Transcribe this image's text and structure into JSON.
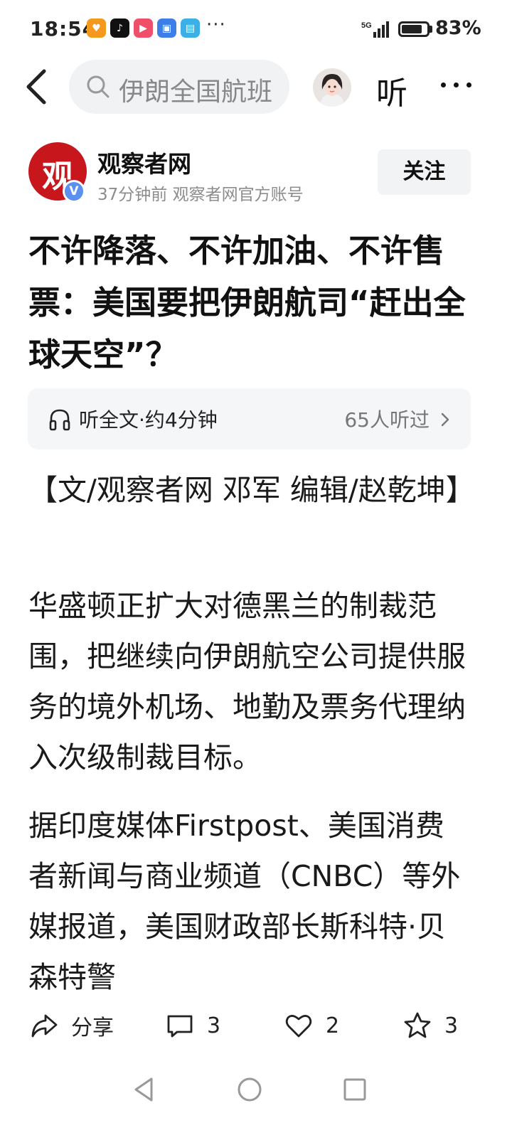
{
  "status_bar": {
    "time": "18:54",
    "network": "5G",
    "battery_text": "83%",
    "battery_level": 0.83,
    "app_icons": [
      "heart-app-icon",
      "tiktok-app-icon",
      "video-app-icon",
      "wallet-app-icon",
      "book-app-icon"
    ],
    "more": "···"
  },
  "top_nav": {
    "search_text": "伊朗全国航班",
    "listen_label": "听"
  },
  "author": {
    "logo_text": "观",
    "name": "观察者网",
    "meta": "37分钟前  观察者网官方账号",
    "verified": "V",
    "follow_label": "关注"
  },
  "article": {
    "title": "不许降落、不许加油、不许售票：美国要把伊朗航司“赶出全球天空”？",
    "audio": {
      "label": "听全文·约4分钟",
      "listeners": "65人听过"
    },
    "byline": "【文/观察者网 邓军 编辑/赵乾坤】",
    "paragraph_1": "华盛顿正扩大对德黑兰的制裁范围，把继续向伊朗航空公司提供服务的境外机场、地勤及票务代理纳入次级制裁目标。",
    "paragraph_2": "据印度媒体Firstpost、美国消费者新闻与商业频道（CNBC）等外媒报道，美国财政部长斯科特·贝森特警"
  },
  "actions": {
    "share_label": "分享",
    "comment_count": "3",
    "like_count": "2",
    "favorite_count": "3"
  },
  "colors": {
    "brand_red": "#c8161d",
    "verified_blue": "#5b8ff0",
    "muted_text": "#8c8c8c",
    "panel_bg": "#f5f6f8"
  }
}
